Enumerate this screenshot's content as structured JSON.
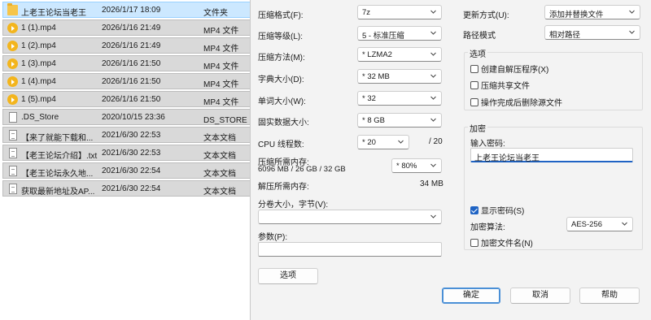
{
  "files": [
    {
      "name": "上老王论坛当老王",
      "date": "2026/1/17 18:09",
      "type": "文件夹",
      "icon": "folder-icon",
      "selected": true
    },
    {
      "name": "1 (1).mp4",
      "date": "2026/1/16 21:49",
      "type": "MP4 文件",
      "icon": "video-file-icon"
    },
    {
      "name": "1 (2).mp4",
      "date": "2026/1/16 21:49",
      "type": "MP4 文件",
      "icon": "video-file-icon"
    },
    {
      "name": "1 (3).mp4",
      "date": "2026/1/16 21:50",
      "type": "MP4 文件",
      "icon": "video-file-icon"
    },
    {
      "name": "1 (4).mp4",
      "date": "2026/1/16 21:50",
      "type": "MP4 文件",
      "icon": "video-file-icon"
    },
    {
      "name": "1 (5).mp4",
      "date": "2026/1/16 21:50",
      "type": "MP4 文件",
      "icon": "video-file-icon"
    },
    {
      "name": ".DS_Store",
      "date": "2020/10/15 23:36",
      "type": "DS_STORE 文",
      "icon": "blank-file-icon"
    },
    {
      "name": "【来了就能下载和...",
      "date": "2021/6/30 22:53",
      "type": "文本文档",
      "icon": "text-file-icon"
    },
    {
      "name": "【老王论坛介绍】.txt",
      "date": "2021/6/30 22:53",
      "type": "文本文档",
      "icon": "text-file-icon"
    },
    {
      "name": "【老王论坛永久地...",
      "date": "2021/6/30 22:54",
      "type": "文本文档",
      "icon": "text-file-icon"
    },
    {
      "name": "获取最新地址及AP...",
      "date": "2021/6/30 22:54",
      "type": "文本文档",
      "icon": "text-file-icon"
    }
  ],
  "dialog": {
    "format_label": "压缩格式(F):",
    "format_value": "7z",
    "level_label": "压缩等级(L):",
    "level_value": "5 - 标准压缩",
    "method_label": "压缩方法(M):",
    "method_value": "* LZMA2",
    "dict_label": "字典大小(D):",
    "dict_value": "* 32 MB",
    "word_label": "单词大小(W):",
    "word_value": "* 32",
    "solid_label": "固实数据大小:",
    "solid_value": "* 8 GB",
    "cpu_label": "CPU 线程数:",
    "cpu_value": "* 20",
    "cpu_max": "/ 20",
    "mem_comp_label": "压缩所需内存:",
    "mem_comp_detail": "6096 MB / 26 GB / 32 GB",
    "mem_pct_value": "* 80%",
    "mem_decomp_label": "解压所需内存:",
    "mem_decomp_value": "34 MB",
    "split_label": "分卷大小，字节(V):",
    "split_value": "",
    "params_label": "参数(P):",
    "params_value": "",
    "options_button": "选项",
    "update_label": "更新方式(U):",
    "update_value": "添加并替换文件",
    "path_label": "路径模式",
    "path_value": "相对路径",
    "options_group_title": "选项",
    "opt_sfx": {
      "label": "创建自解压程序(X)",
      "checked": false
    },
    "opt_shared": {
      "label": "压缩共享文件",
      "checked": false
    },
    "opt_delete": {
      "label": "操作完成后删除源文件",
      "checked": false
    },
    "encrypt_group_title": "加密",
    "pwd_label": "输入密码:",
    "pwd_value": "上老王论坛当老王",
    "show_pwd": {
      "label": "显示密码(S)",
      "checked": true
    },
    "enc_method_label": "加密算法:",
    "enc_method_value": "AES-256",
    "enc_names": {
      "label": "加密文件名(N)",
      "checked": false
    },
    "ok_button": "确定",
    "cancel_button": "取消",
    "help_button": "帮助"
  }
}
